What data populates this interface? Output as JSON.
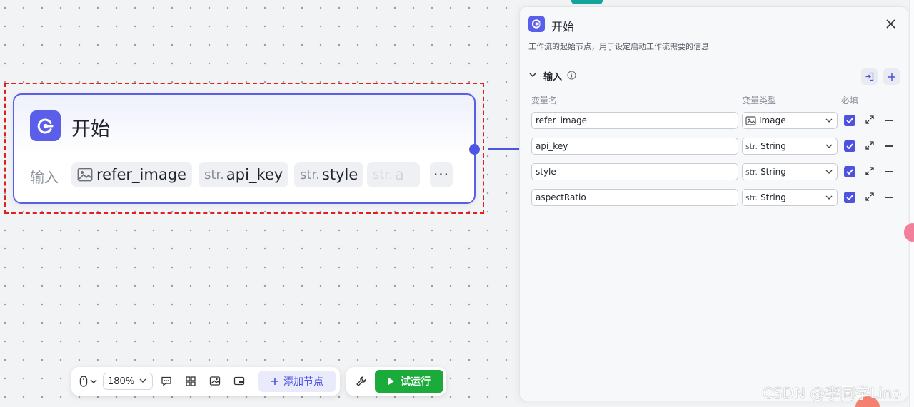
{
  "canvas": {
    "node": {
      "title": "开始",
      "input_label": "输入",
      "params": [
        {
          "prefix": "",
          "name": "refer_image",
          "icon": "image-icon"
        },
        {
          "prefix": "str.",
          "name": "api_key"
        },
        {
          "prefix": "str.",
          "name": "style"
        },
        {
          "prefix": "str.",
          "name": "a"
        }
      ],
      "more": "···"
    }
  },
  "toolbar": {
    "zoom": "180%",
    "add_node_label": "添加节点",
    "run_label": "试运行",
    "icons": [
      "mouse-icon",
      "chevron-down-icon",
      "comment-icon",
      "layout-icon",
      "image-icon",
      "minimap-icon",
      "wrench-icon",
      "play-icon"
    ]
  },
  "panel": {
    "title": "开始",
    "description": "工作流的起始节点，用于设定启动工作流需要的信息",
    "section_title": "输入",
    "columns": {
      "name": "变量名",
      "type": "变量类型",
      "required": "必填"
    },
    "variables": [
      {
        "name": "refer_image",
        "type_prefix": "",
        "type": "Image",
        "required": true
      },
      {
        "name": "api_key",
        "type_prefix": "str.",
        "type": "String",
        "required": true
      },
      {
        "name": "style",
        "type_prefix": "str.",
        "type": "String",
        "required": true
      },
      {
        "name": "aspectRatio",
        "type_prefix": "str.",
        "type": "String",
        "required": true
      }
    ]
  },
  "watermark": "CSDN @李同学Lino",
  "colors": {
    "accent": "#5a5ee9",
    "run_green": "#1bab3b",
    "selection_red": "#e0201e"
  }
}
